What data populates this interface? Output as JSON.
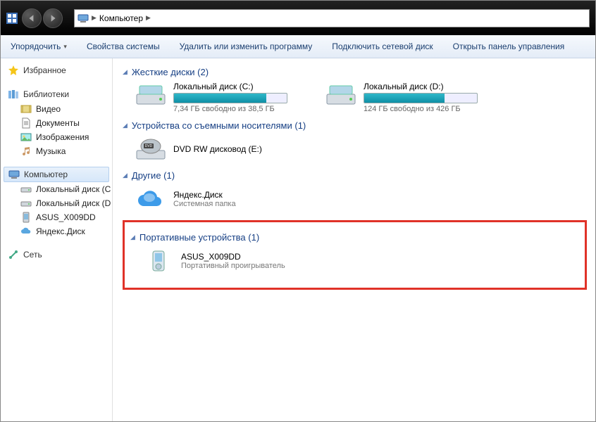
{
  "address": {
    "root_label": "Компьютер"
  },
  "toolbar": {
    "organize": "Упорядочить",
    "properties": "Свойства системы",
    "change_program": "Удалить или изменить программу",
    "map_drive": "Подключить сетевой диск",
    "control_panel": "Открыть панель управления"
  },
  "sidebar": {
    "favorites": "Избранное",
    "libraries": "Библиотеки",
    "lib_items": {
      "video": "Видео",
      "documents": "Документы",
      "pictures": "Изображения",
      "music": "Музыка"
    },
    "computer": "Компьютер",
    "comp_items": {
      "c": "Локальный диск (C",
      "d": "Локальный диск (D",
      "asus": "ASUS_X009DD",
      "yadisk": "Яндекс.Диск"
    },
    "network": "Сеть"
  },
  "sections": {
    "hdd": {
      "title": "Жесткие диски (2)",
      "drives": [
        {
          "name": "Локальный диск (C:)",
          "free": "7,34 ГБ свободно из 38,5 ГБ",
          "fill_pct": 82
        },
        {
          "name": "Локальный диск (D:)",
          "free": "124 ГБ свободно из 426 ГБ",
          "fill_pct": 71
        }
      ]
    },
    "removable": {
      "title": "Устройства со съемными носителями (1)",
      "item": {
        "name": "DVD RW дисковод (E:)"
      }
    },
    "other": {
      "title": "Другие (1)",
      "item": {
        "name": "Яндекс.Диск",
        "sub": "Системная папка"
      }
    },
    "portable": {
      "title": "Портативные устройства (1)",
      "item": {
        "name": "ASUS_X009DD",
        "sub": "Портативный проигрыватель"
      }
    }
  }
}
